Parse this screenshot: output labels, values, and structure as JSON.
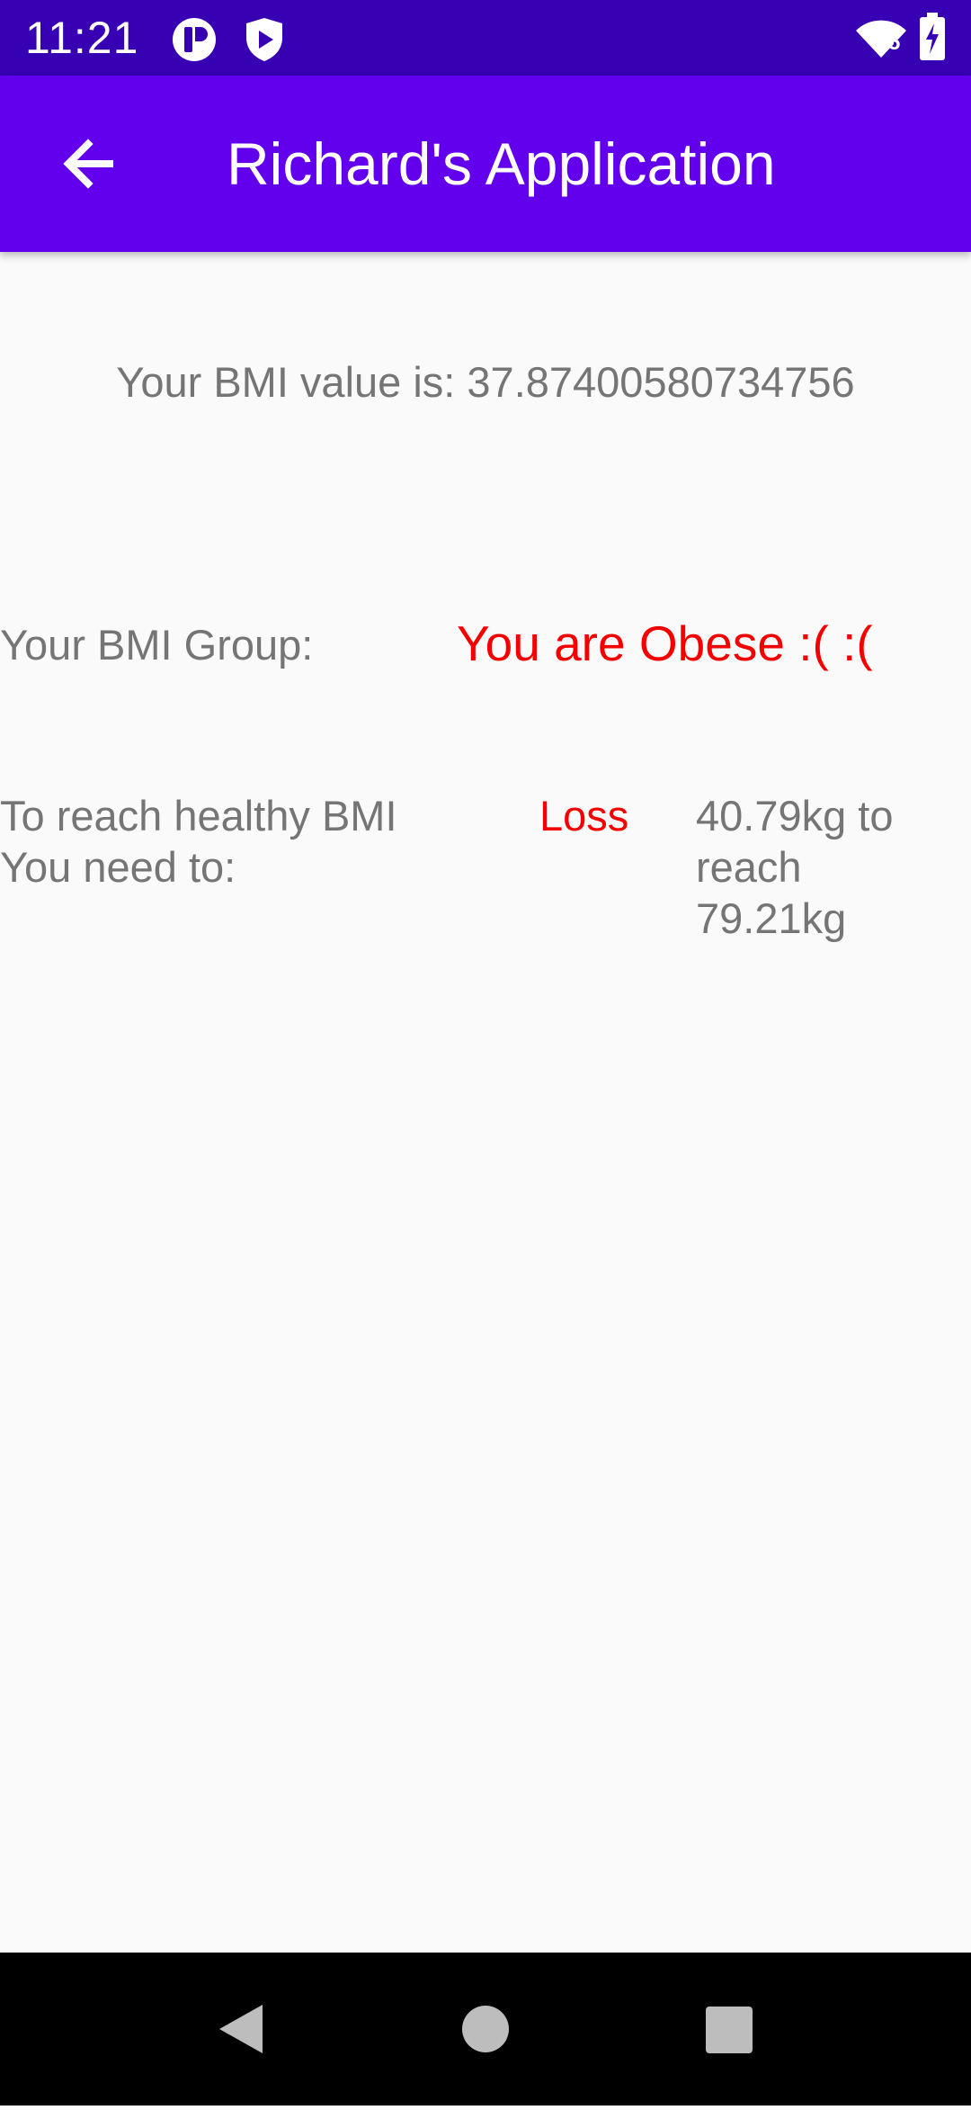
{
  "status_bar": {
    "time": "11:21",
    "icons": [
      "notification-app-icon",
      "shield-play-icon",
      "wifi-icon",
      "battery-charging-icon"
    ],
    "wifi_badge": "5"
  },
  "app_bar": {
    "title": "Richard's Application",
    "back_icon": "arrow-back-icon",
    "background": "#6200EE",
    "status_background": "#3700B3"
  },
  "result": {
    "bmi_text": "Your BMI value is: 37.87400580734756",
    "group_label": "Your BMI Group:",
    "group_value": "You are Obese :( :(",
    "need_label": "To reach healthy BMI You need to:",
    "need_action": "Loss",
    "need_amount": "40.79kg to reach 79.21kg",
    "accent_color": "#F50000",
    "text_color": "#757575"
  },
  "nav_bar": {
    "buttons": [
      "back-triangle-icon",
      "home-circle-icon",
      "recents-square-icon"
    ]
  }
}
